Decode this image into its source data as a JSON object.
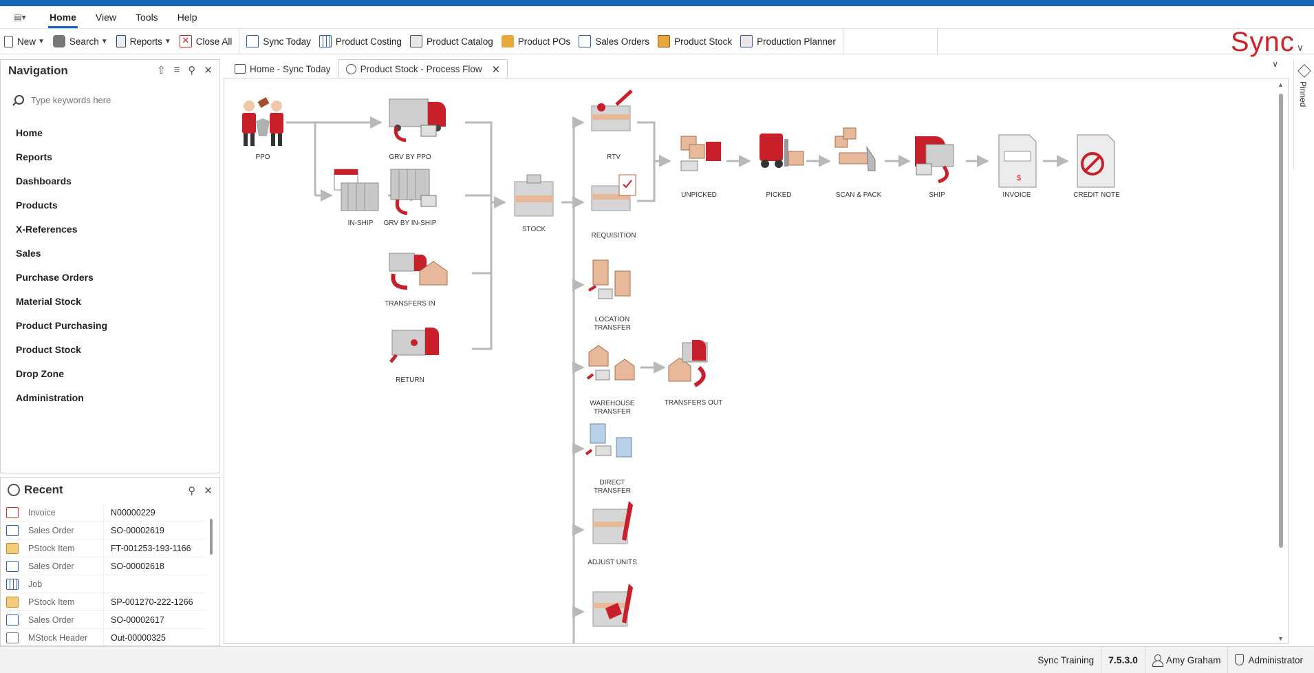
{
  "menubar": {
    "items": [
      {
        "label": "Home",
        "active": true
      },
      {
        "label": "View"
      },
      {
        "label": "Tools"
      },
      {
        "label": "Help"
      }
    ]
  },
  "toolbar": {
    "buttons": [
      {
        "label": "New",
        "icon": "document-icon",
        "dropdown": true
      },
      {
        "label": "Search",
        "icon": "binoculars-icon",
        "dropdown": true
      },
      {
        "label": "Reports",
        "icon": "report-icon",
        "dropdown": true
      },
      {
        "label": "Close All",
        "icon": "close-all-icon"
      },
      {
        "label": "Sync Today",
        "icon": "home-icon"
      },
      {
        "label": "Product Costing",
        "icon": "grid-icon"
      },
      {
        "label": "Product Catalog",
        "icon": "catalog-icon"
      },
      {
        "label": "Product POs",
        "icon": "bag-icon"
      },
      {
        "label": "Sales Orders",
        "icon": "sales-icon"
      },
      {
        "label": "Product Stock",
        "icon": "stock-icon"
      },
      {
        "label": "Production Planner",
        "icon": "planner-icon"
      }
    ],
    "logo": "Sync"
  },
  "navigation": {
    "title": "Navigation",
    "search_placeholder": "Type keywords here",
    "items": [
      "Home",
      "Reports",
      "Dashboards",
      "Products",
      "X-References",
      "Sales",
      "Purchase Orders",
      "Material Stock",
      "Product Purchasing",
      "Product Stock",
      "Drop Zone",
      "Administration"
    ]
  },
  "recent": {
    "title": "Recent",
    "rows": [
      {
        "type": "Invoice",
        "value": "N00000229"
      },
      {
        "type": "Sales Order",
        "value": "SO-00002619"
      },
      {
        "type": "PStock Item",
        "value": "FT-001253-193-1166"
      },
      {
        "type": "Sales Order",
        "value": "SO-00002618"
      },
      {
        "type": "Job",
        "value": ""
      },
      {
        "type": "PStock Item",
        "value": "SP-001270-222-1266"
      },
      {
        "type": "Sales Order",
        "value": "SO-00002617"
      },
      {
        "type": "MStock Header",
        "value": "Out-00000325"
      }
    ]
  },
  "tabs": [
    {
      "label": "Home - Sync Today",
      "active": false
    },
    {
      "label": "Product Stock - Process Flow",
      "active": true
    }
  ],
  "flow": {
    "nodes": {
      "ppo": "PPO",
      "grv_ppo": "GRV BY PPO",
      "in_ship": "IN-SHIP",
      "grv_inship": "GRV BY IN-SHIP",
      "transfers_in": "TRANSFERS IN",
      "return": "RETURN",
      "stock": "STOCK",
      "rtv": "RTV",
      "requisition": "REQUISITION",
      "unpicked": "UNPICKED",
      "picked": "PICKED",
      "scan_pack": "SCAN & PACK",
      "ship": "SHIP",
      "invoice": "INVOICE",
      "credit_note": "CREDIT NOTE",
      "location_transfer_1": "LOCATION",
      "location_transfer_2": "TRANSFER",
      "warehouse_transfer_1": "WAREHOUSE",
      "warehouse_transfer_2": "TRANSFER",
      "transfers_out": "TRANSFERS OUT",
      "direct_transfer_1": "DIRECT",
      "direct_transfer_2": "TRANSFER",
      "adjust_units": "ADJUST UNITS"
    }
  },
  "pinned": "Pinned",
  "status": {
    "company": "Sync Training",
    "version": "7.5.3.0",
    "user": "Amy Graham",
    "role": "Administrator"
  },
  "colors": {
    "accent": "#1465b8",
    "brand": "#d0202a",
    "flow_line": "#b8b8b8"
  }
}
